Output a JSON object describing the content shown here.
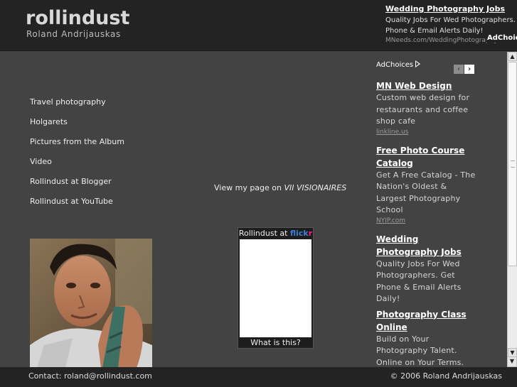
{
  "header": {
    "site_title": "rollindust",
    "subtitle": "Roland Andrijauskas"
  },
  "top_ad": {
    "title": "Wedding Photography Jobs",
    "desc_line1": "Quality Jobs For Wed Photographers. Get",
    "desc_line2": "Phone & Email Alerts Daily!",
    "url": "MNeeds.com/WeddingPhotography",
    "adchoices": "AdChoices"
  },
  "nav": {
    "items": [
      {
        "label": "Travel photography"
      },
      {
        "label": "Holgarets"
      },
      {
        "label": "Pictures from the Album"
      },
      {
        "label": "Video"
      },
      {
        "label": "Rollindust at Blogger"
      },
      {
        "label": "Rollindust at YouTube"
      }
    ]
  },
  "visionaires": {
    "prefix": "View my page on ",
    "link": "VII VISIONAIRES"
  },
  "flickr": {
    "header_text": "Rollindust at ",
    "brand_part1": "flick",
    "brand_part2": "r",
    "footer_link": "What is this?"
  },
  "side_ads": {
    "adchoices": "AdChoices",
    "prev_icon": "‹",
    "next_icon": "›",
    "items": [
      {
        "title": "MN Web Design",
        "desc": "Custom web design for restaurants and coffee shop cafe",
        "url": "linkline.us"
      },
      {
        "title": "Free Photo Course Catalog",
        "desc": "Get A Free Catalog - The Nation's Oldest & Largest Photography School",
        "url": "NYIP.com"
      },
      {
        "title": "Wedding Photography Jobs",
        "desc": "Quality Jobs For Wed Photographers. Get Phone & Email Alerts Daily!",
        "url": ""
      },
      {
        "title": "Photography Class Online",
        "desc": "Build on Your Photography Talent. Online on Your Terms. Start Today!",
        "url": ""
      }
    ]
  },
  "scrollbar": {
    "up_icon": "▲",
    "down_icon": "▼"
  },
  "footer": {
    "contact": "Contact: roland@rollindust.com",
    "copyright": "© 2006 Roland Andrijauskas"
  }
}
